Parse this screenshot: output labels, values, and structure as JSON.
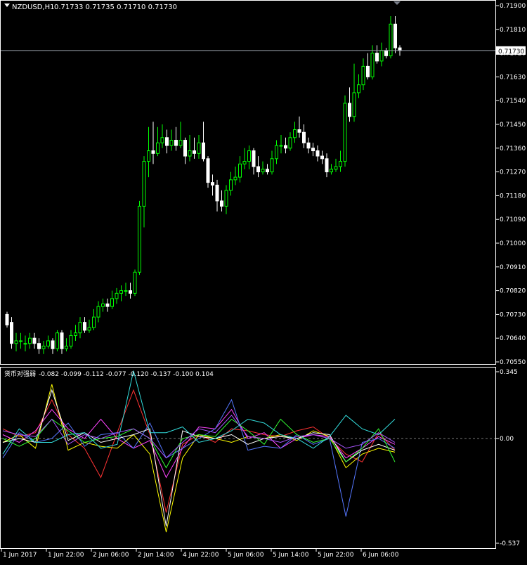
{
  "main_chart": {
    "symbol_label": "NZDUSD,H1",
    "ohlc_label": "0.71733 0.71735 0.71710 0.71730",
    "current_price": "0.71730",
    "price_ticks": [
      "0.71900",
      "0.71810",
      "0.71720",
      "0.71630",
      "0.71540",
      "0.71450",
      "0.71360",
      "0.71270",
      "0.71180",
      "0.71090",
      "0.71000",
      "0.70910",
      "0.70820",
      "0.70730",
      "0.70640",
      "0.70550"
    ],
    "candle_up_color": "#00ff00",
    "candle_down_color": "#ffffff",
    "candles": [
      [
        0.7073,
        0.7069,
        0.7068,
        0.7074
      ],
      [
        0.707,
        0.7062,
        0.706,
        0.7072
      ],
      [
        0.7062,
        0.7063,
        0.7059,
        0.7066
      ],
      [
        0.7063,
        0.7063,
        0.706,
        0.7066
      ],
      [
        0.7062,
        0.7062,
        0.7059,
        0.7065
      ],
      [
        0.7062,
        0.7064,
        0.706,
        0.7066
      ],
      [
        0.7064,
        0.7062,
        0.706,
        0.7066
      ],
      [
        0.7062,
        0.706,
        0.7058,
        0.7064
      ],
      [
        0.706,
        0.7061,
        0.7058,
        0.7063
      ],
      [
        0.7061,
        0.7063,
        0.706,
        0.7065
      ],
      [
        0.7063,
        0.706,
        0.7058,
        0.7064
      ],
      [
        0.706,
        0.7066,
        0.7059,
        0.7067
      ],
      [
        0.7066,
        0.706,
        0.7058,
        0.7067
      ],
      [
        0.706,
        0.7061,
        0.7059,
        0.7064
      ],
      [
        0.7061,
        0.7065,
        0.706,
        0.7067
      ],
      [
        0.7065,
        0.7066,
        0.7063,
        0.7069
      ],
      [
        0.7066,
        0.707,
        0.7064,
        0.7072
      ],
      [
        0.707,
        0.7067,
        0.7066,
        0.7072
      ],
      [
        0.7067,
        0.7068,
        0.7066,
        0.7071
      ],
      [
        0.7068,
        0.7072,
        0.7067,
        0.7075
      ],
      [
        0.7072,
        0.7076,
        0.707,
        0.7078
      ],
      [
        0.7076,
        0.7077,
        0.7074,
        0.7079
      ],
      [
        0.7077,
        0.7076,
        0.7074,
        0.7079
      ],
      [
        0.7076,
        0.7079,
        0.7075,
        0.7082
      ],
      [
        0.7079,
        0.7081,
        0.7077,
        0.7083
      ],
      [
        0.7081,
        0.7082,
        0.7078,
        0.7084
      ],
      [
        0.7082,
        0.7082,
        0.708,
        0.7085
      ],
      [
        0.7082,
        0.7081,
        0.7079,
        0.7085
      ],
      [
        0.7081,
        0.7089,
        0.708,
        0.709
      ],
      [
        0.7089,
        0.7114,
        0.7088,
        0.7116
      ],
      [
        0.7114,
        0.7131,
        0.7106,
        0.7133
      ],
      [
        0.7131,
        0.7135,
        0.7125,
        0.7144
      ],
      [
        0.7135,
        0.7134,
        0.713,
        0.7146
      ],
      [
        0.7134,
        0.7138,
        0.7133,
        0.7144
      ],
      [
        0.7138,
        0.714,
        0.7136,
        0.7145
      ],
      [
        0.714,
        0.7137,
        0.7134,
        0.7143
      ],
      [
        0.7137,
        0.7139,
        0.7135,
        0.7143
      ],
      [
        0.7139,
        0.7137,
        0.7135,
        0.7144
      ],
      [
        0.7137,
        0.7139,
        0.7136,
        0.7146
      ],
      [
        0.7139,
        0.7133,
        0.713,
        0.714
      ],
      [
        0.7133,
        0.7135,
        0.7131,
        0.7141
      ],
      [
        0.7135,
        0.7134,
        0.7132,
        0.714
      ],
      [
        0.7134,
        0.7138,
        0.7132,
        0.7141
      ],
      [
        0.7138,
        0.7132,
        0.7131,
        0.7146
      ],
      [
        0.7132,
        0.7123,
        0.7121,
        0.7133
      ],
      [
        0.7123,
        0.7122,
        0.7118,
        0.7126
      ],
      [
        0.7122,
        0.7116,
        0.7112,
        0.7124
      ],
      [
        0.7116,
        0.7114,
        0.7112,
        0.712
      ],
      [
        0.7114,
        0.712,
        0.7111,
        0.7122
      ],
      [
        0.712,
        0.7124,
        0.7118,
        0.7127
      ],
      [
        0.7124,
        0.7125,
        0.7122,
        0.7129
      ],
      [
        0.7125,
        0.713,
        0.7123,
        0.7133
      ],
      [
        0.713,
        0.7131,
        0.7128,
        0.7136
      ],
      [
        0.7131,
        0.7135,
        0.7128,
        0.7137
      ],
      [
        0.7135,
        0.7129,
        0.7126,
        0.7136
      ],
      [
        0.7129,
        0.7127,
        0.7125,
        0.7133
      ],
      [
        0.7127,
        0.7128,
        0.7126,
        0.7131
      ],
      [
        0.7128,
        0.7127,
        0.7126,
        0.713
      ],
      [
        0.7127,
        0.7132,
        0.7126,
        0.7135
      ],
      [
        0.7132,
        0.7137,
        0.713,
        0.7139
      ],
      [
        0.7137,
        0.7137,
        0.7134,
        0.7141
      ],
      [
        0.7137,
        0.7136,
        0.7134,
        0.714
      ],
      [
        0.7136,
        0.714,
        0.7135,
        0.7142
      ],
      [
        0.714,
        0.7143,
        0.7138,
        0.7146
      ],
      [
        0.7143,
        0.7142,
        0.714,
        0.7148
      ],
      [
        0.7142,
        0.7138,
        0.7136,
        0.7145
      ],
      [
        0.7138,
        0.7136,
        0.7134,
        0.714
      ],
      [
        0.7136,
        0.7135,
        0.7133,
        0.7138
      ],
      [
        0.7135,
        0.7133,
        0.7131,
        0.7137
      ],
      [
        0.7133,
        0.7132,
        0.713,
        0.7135
      ],
      [
        0.7132,
        0.7127,
        0.7125,
        0.7134
      ],
      [
        0.7127,
        0.7128,
        0.7126,
        0.713
      ],
      [
        0.7128,
        0.7129,
        0.7127,
        0.7132
      ],
      [
        0.7129,
        0.7131,
        0.7127,
        0.7135
      ],
      [
        0.7131,
        0.7153,
        0.7129,
        0.7156
      ],
      [
        0.7153,
        0.7148,
        0.7146,
        0.7159
      ],
      [
        0.7148,
        0.7157,
        0.7146,
        0.7168
      ],
      [
        0.7157,
        0.716,
        0.7155,
        0.7164
      ],
      [
        0.716,
        0.7167,
        0.7158,
        0.717
      ],
      [
        0.7167,
        0.7163,
        0.7162,
        0.7172
      ],
      [
        0.7163,
        0.7172,
        0.7162,
        0.7175
      ],
      [
        0.7172,
        0.7169,
        0.7168,
        0.7175
      ],
      [
        0.7169,
        0.7173,
        0.7167,
        0.7176
      ],
      [
        0.7173,
        0.7171,
        0.717,
        0.7174
      ],
      [
        0.7171,
        0.7183,
        0.717,
        0.7186
      ],
      [
        0.7183,
        0.7174,
        0.7172,
        0.7186
      ],
      [
        0.7174,
        0.7173,
        0.7171,
        0.7175
      ]
    ]
  },
  "indicator": {
    "label": "货币对强弱",
    "values_label": "-0.082 -0.099 -0.112 -0.077 -0.120 -0.137 -0.100 0.104",
    "scale_top": "0.345",
    "scale_zero": "0.00",
    "scale_bottom": "-0.537",
    "line_colors": [
      "#ff3333",
      "#ffff00",
      "#ff44ff",
      "#5577ff",
      "#ffffff",
      "#33ff33",
      "#33dddd",
      "#aa55ff"
    ],
    "anchors": [
      [
        0.05,
        0.01,
        0.03,
        0.2,
        0.02,
        -0.05,
        -0.2,
        0.03,
        0.25,
        0.02,
        -0.38,
        -0.03,
        0.02,
        -0.02,
        0.05,
        0.04,
        0.02,
        0.01,
        0.04,
        0.06,
        0.0,
        -0.08,
        -0.12,
        0.03,
        -0.06
      ],
      [
        -0.02,
        0.02,
        -0.05,
        0.28,
        -0.06,
        -0.02,
        -0.04,
        -0.05,
        0.02,
        -0.08,
        -0.48,
        -0.1,
        0.02,
        0.0,
        -0.02,
        0.01,
        0.0,
        0.02,
        -0.01,
        0.04,
        0.01,
        -0.15,
        -0.08,
        -0.05,
        -0.07
      ],
      [
        0.02,
        -0.02,
        0.04,
        0.15,
        0.05,
        0.0,
        0.1,
        0.0,
        -0.05,
        -0.01,
        -0.2,
        -0.05,
        0.06,
        0.05,
        0.15,
        0.0,
        0.03,
        -0.05,
        0.0,
        0.02,
        0.01,
        -0.1,
        -0.05,
        0.01,
        -0.03
      ],
      [
        -0.1,
        0.03,
        -0.02,
        0.0,
        0.08,
        -0.04,
        0.02,
        0.03,
        -0.05,
        0.08,
        -0.1,
        -0.05,
        0.0,
        0.05,
        0.2,
        -0.06,
        -0.04,
        -0.05,
        0.02,
        -0.03,
        0.0,
        -0.4,
        -0.02,
        0.0,
        -0.05
      ],
      [
        -0.02,
        0.0,
        -0.02,
        0.25,
        -0.01,
        0.03,
        -0.02,
        0.0,
        0.02,
        0.05,
        -0.45,
        0.04,
        0.01,
        0.0,
        0.02,
        -0.03,
        0.0,
        0.01,
        0.0,
        0.03,
        0.02,
        -0.12,
        -0.06,
        -0.03,
        -0.06
      ],
      [
        0.0,
        -0.04,
        0.0,
        0.1,
        0.04,
        -0.02,
        0.0,
        0.01,
        0.05,
        0.0,
        -0.15,
        0.0,
        0.02,
        0.01,
        0.1,
        0.04,
        -0.03,
        0.1,
        0.02,
        -0.02,
        0.0,
        -0.12,
        -0.05,
        0.05,
        -0.12
      ],
      [
        -0.08,
        0.05,
        -0.02,
        -0.02,
        0.02,
        0.03,
        -0.05,
        -0.03,
        0.35,
        0.03,
        0.03,
        0.06,
        -0.02,
        0.0,
        0.04,
        0.1,
        0.08,
        0.02,
        0.0,
        -0.05,
        0.01,
        0.12,
        0.05,
        0.02,
        0.1
      ],
      [
        0.04,
        0.02,
        0.01,
        0.1,
        -0.03,
        0.02,
        0.0,
        0.03,
        0.05,
        0.0,
        -0.1,
        -0.02,
        0.05,
        0.03,
        0.12,
        0.01,
        0.0,
        -0.02,
        0.01,
        0.02,
        0.0,
        -0.05,
        -0.03,
        0.03,
        -0.02
      ]
    ]
  },
  "time_axis": {
    "labels": [
      "1 Jun 2017",
      "1 Jun 22:00",
      "2 Jun 06:00",
      "2 Jun 14:00",
      "4 Jun 22:00",
      "5 Jun 06:00",
      "5 Jun 14:00",
      "5 Jun 22:00",
      "6 Jun 06:00"
    ]
  }
}
